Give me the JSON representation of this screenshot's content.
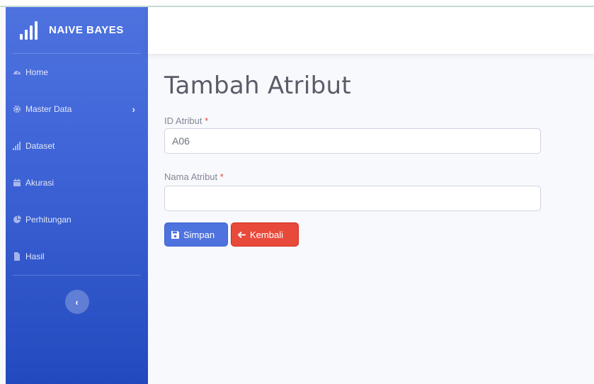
{
  "sidebar": {
    "brand": "NAIVE BAYES",
    "items": [
      {
        "label": "Home",
        "icon": "tachometer-icon"
      },
      {
        "label": "Master Data",
        "icon": "gear-icon",
        "has_submenu": true
      },
      {
        "label": "Dataset",
        "icon": "signal-bars-icon"
      },
      {
        "label": "Akurasi",
        "icon": "calendar-icon"
      },
      {
        "label": "Perhitungan",
        "icon": "pie-chart-icon"
      },
      {
        "label": "Hasil",
        "icon": "file-icon"
      }
    ],
    "toggle_icon": "chevron-left-icon"
  },
  "main": {
    "title": "Tambah Atribut",
    "fields": [
      {
        "label": "ID Atribut",
        "required_mark": "*",
        "value": "A06",
        "placeholder": ""
      },
      {
        "label": "Nama Atribut",
        "required_mark": "*",
        "value": "",
        "placeholder": ""
      }
    ],
    "buttons": {
      "save_label": "Simpan",
      "back_label": "Kembali"
    }
  },
  "colors": {
    "primary": "#4e73df",
    "danger": "#e74a3b",
    "sidebar_dark": "#224abe"
  }
}
